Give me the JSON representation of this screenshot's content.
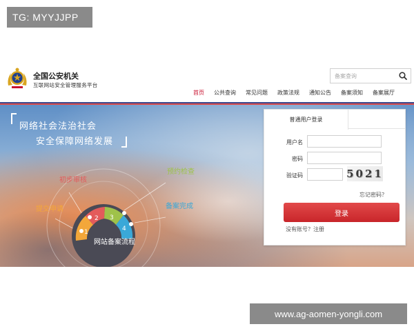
{
  "watermark_top": "TG: MYYJJPP",
  "watermark_bottom": "www.ag-aomen-yongli.com",
  "header": {
    "emblem_icon": "police-emblem-icon",
    "title": "全国公安机关",
    "subtitle": "互联网站安全管理服务平台",
    "search_placeholder": "备案查询",
    "search_icon": "search-icon"
  },
  "nav": {
    "items": [
      "首页",
      "公共查询",
      "常见问题",
      "政策法规",
      "通知公告",
      "备案须知",
      "备案展厅"
    ],
    "active": "首页"
  },
  "colors": {
    "accent_red": "#c8102e",
    "nav_rule_blue": "#3b4a8f",
    "login_button": "#d93636"
  },
  "hero": {
    "slogan_line1": "网络社会法治社会",
    "slogan_line2": "安全保障网络发展",
    "steps": [
      {
        "num": "1",
        "label": "提交申请"
      },
      {
        "num": "2",
        "label": "初步审核"
      },
      {
        "num": "3",
        "label": "预约检查"
      },
      {
        "num": "4",
        "label": "备案完成"
      }
    ],
    "flow_caption": "网站备案流程"
  },
  "login": {
    "tab_label": "普通用户登录",
    "username_label": "用户名",
    "password_label": "密码",
    "captcha_label": "验证码",
    "captcha_text": "5021",
    "forgot_link": "忘记密码？",
    "login_button": "登录",
    "register_link": "没有账号？注册"
  }
}
